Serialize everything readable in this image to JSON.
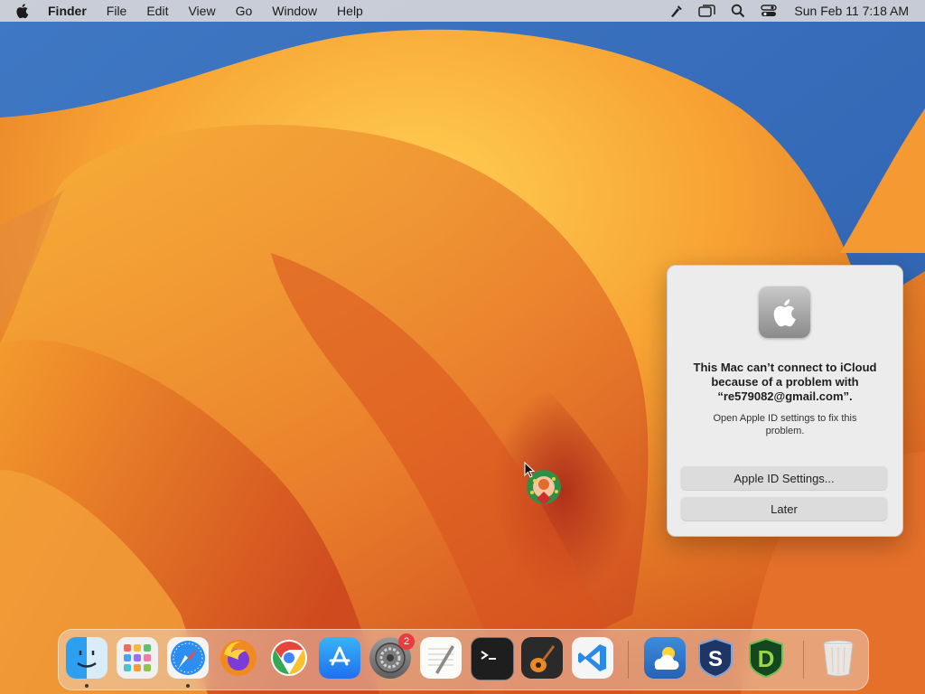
{
  "menubar": {
    "app_name": "Finder",
    "items": [
      "File",
      "Edit",
      "View",
      "Go",
      "Window",
      "Help"
    ],
    "clock": "Sun Feb 11  7:18 AM",
    "status_icons": [
      "pen-tool-icon",
      "screen-mirroring-icon",
      "spotlight-search-icon",
      "control-center-icon"
    ]
  },
  "dialog": {
    "title": "This Mac can’t connect to iCloud because of a problem with “re579082@gmail.com”.",
    "message": "Open Apple ID settings to fix this problem.",
    "primary_button": "Apple ID Settings...",
    "secondary_button": "Later"
  },
  "dock": {
    "apps": [
      {
        "name": "Finder",
        "running": true
      },
      {
        "name": "Launchpad",
        "running": false
      },
      {
        "name": "Safari",
        "running": true
      },
      {
        "name": "Firefox",
        "running": false
      },
      {
        "name": "Google Chrome",
        "running": false
      },
      {
        "name": "App Store",
        "running": false
      },
      {
        "name": "System Settings",
        "running": false,
        "badge": "2"
      },
      {
        "name": "TextEdit",
        "running": false
      },
      {
        "name": "Terminal",
        "running": false
      },
      {
        "name": "GarageBand",
        "running": false
      },
      {
        "name": "Visual Studio Code",
        "running": false
      },
      {
        "name": "Weather",
        "running": false
      },
      {
        "name": "Scrivener",
        "running": false
      },
      {
        "name": "DEVONthink",
        "running": false
      },
      {
        "name": "Trash",
        "running": false
      }
    ]
  },
  "colors": {
    "dialog_bg": "#ececec",
    "button_bg": "#dcdcdc",
    "badge": "#ea3c3c"
  }
}
